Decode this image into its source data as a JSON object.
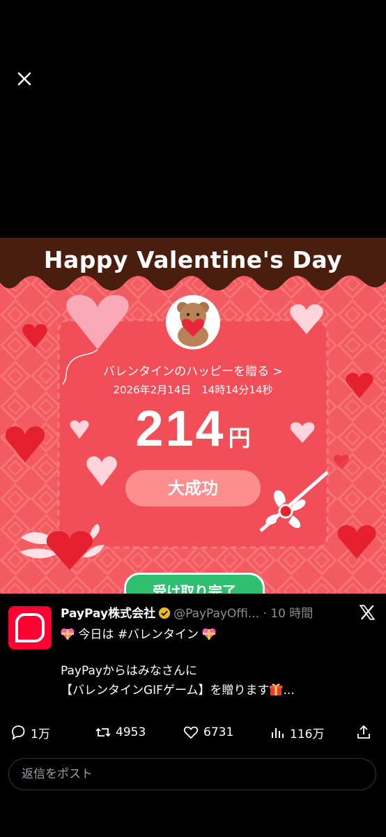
{
  "viewer": {
    "close_icon": "close-icon"
  },
  "media": {
    "title": "Happy Valentine's Day",
    "link_text": "バレンタインのハッピーを贈る >",
    "datetime": "2026年2月14日　14時14分14秒",
    "amount": "214",
    "currency": "円",
    "result_label": "大成功",
    "received_button": "受け取り完了",
    "colors": {
      "brown": "#4a1e0e",
      "pink": "#f25c60",
      "card": "#f24e58",
      "green": "#2fbf71"
    }
  },
  "tweet": {
    "author_name": "PayPay株式会社",
    "handle": "@PayPayOffi...",
    "time": "· 10 時間",
    "line1_prefix": "今日は ",
    "hashtag": "#バレンタイン",
    "line2": "PayPayからはみなさんに",
    "line3": "【バレンタインGIFゲーム】を贈ります",
    "line3_suffix": "...",
    "actions": {
      "replies": "1万",
      "retweets": "4953",
      "likes": "6731",
      "views": "116万"
    },
    "reply_placeholder": "返信をポスト"
  }
}
